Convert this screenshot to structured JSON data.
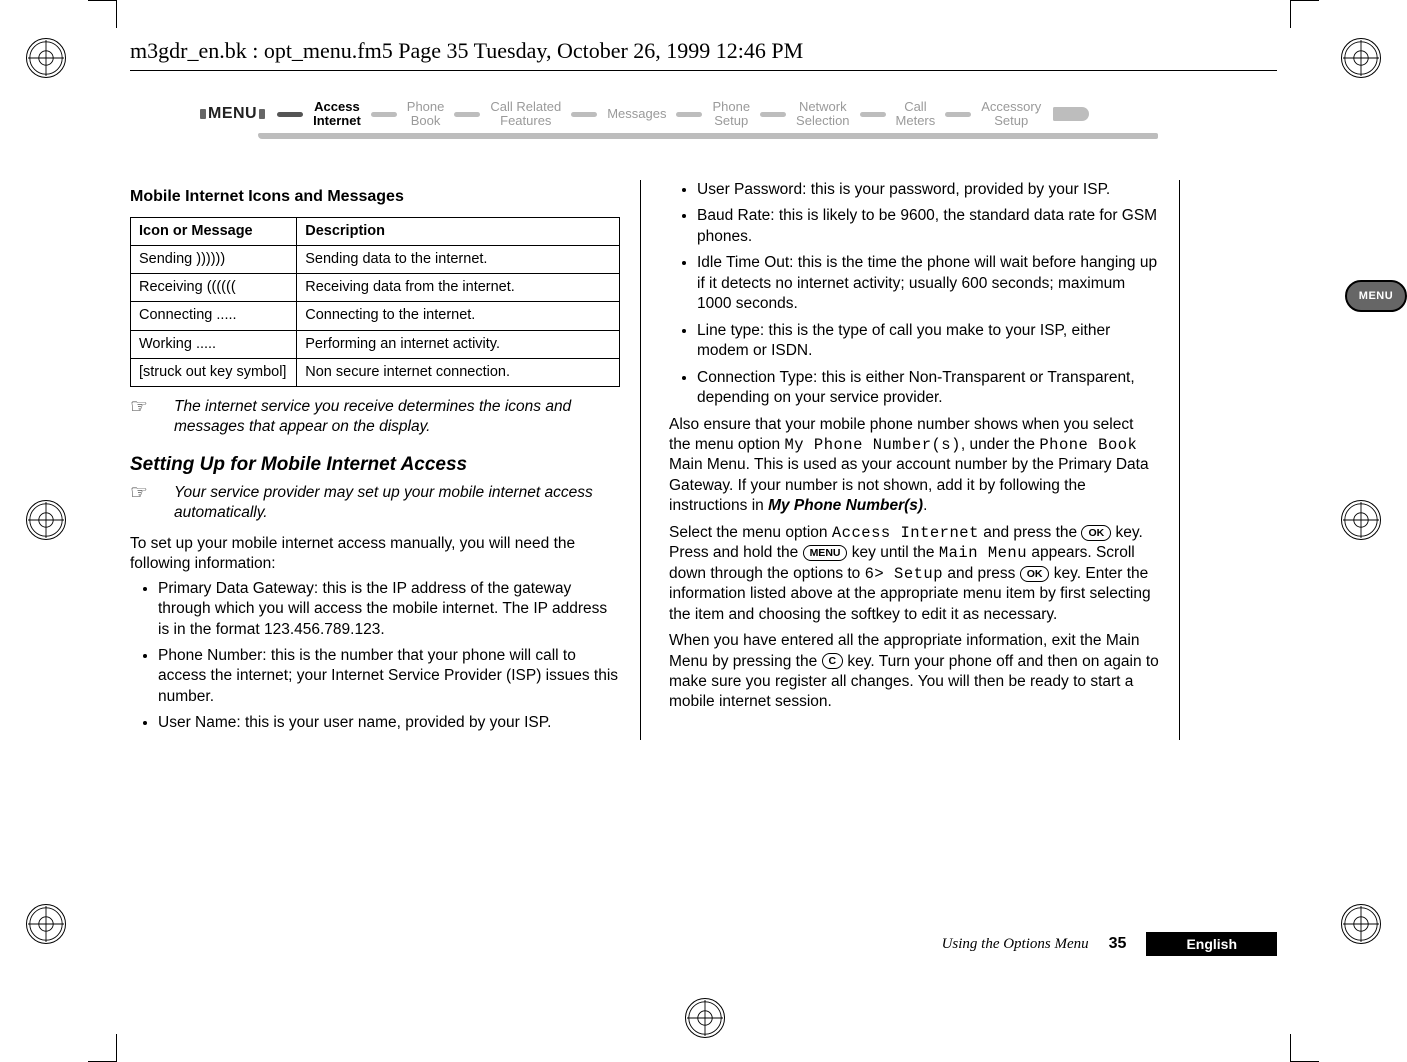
{
  "file_header": "m3gdr_en.bk : opt_menu.fm5  Page 35  Tuesday, October 26, 1999  12:46 PM",
  "menu": {
    "label": "MENU",
    "items": [
      {
        "top": "Access",
        "bottom": "Internet",
        "active": true
      },
      {
        "top": "Phone",
        "bottom": "Book",
        "active": false
      },
      {
        "top": "Call Related",
        "bottom": "Features",
        "active": false
      },
      {
        "top": "Messages",
        "bottom": "",
        "active": false
      },
      {
        "top": "Phone",
        "bottom": "Setup",
        "active": false
      },
      {
        "top": "Network",
        "bottom": "Selection",
        "active": false
      },
      {
        "top": "Call",
        "bottom": "Meters",
        "active": false
      },
      {
        "top": "Accessory",
        "bottom": "Setup",
        "active": false
      }
    ]
  },
  "left": {
    "section_title": "Mobile Internet Icons and Messages",
    "table_headers": {
      "col1": "Icon or Message",
      "col2": "Description"
    },
    "table_rows": [
      {
        "c1": "Sending ))))))",
        "c2": "Sending data to the internet."
      },
      {
        "c1": "Receiving ((((((",
        "c2": "Receiving data from the internet."
      },
      {
        "c1": "Connecting .....",
        "c2": "Connecting to the internet."
      },
      {
        "c1": "Working .....",
        "c2": "Performing an internet activity."
      },
      {
        "c1": "[struck out key symbol]",
        "c2": "Non secure internet connection."
      }
    ],
    "note1": "The internet service you receive determines the icons and messages that appear on the display.",
    "subheading": "Setting Up for Mobile Internet Access",
    "note2": "Your service provider may set up your mobile internet access automatically.",
    "para1": "To set up your mobile internet access manually, you will need the following information:",
    "bullets": [
      "Primary Data Gateway: this is the IP address of the gateway through which you will access the mobile internet. The IP address is in the format 123.456.789.123.",
      "Phone Number: this is the number that your phone will call to access the internet; your Internet Service Provider (ISP) issues this number.",
      "User Name: this is your user name, provided by your ISP."
    ]
  },
  "right": {
    "bullets": [
      "User Password: this is your password, provided by your ISP.",
      "Baud Rate: this is likely to be 9600, the standard data rate for GSM phones.",
      "Idle Time Out: this is the time the phone will wait before hanging up if it detects no internet activity; usually 600 seconds; maximum 1000 seconds.",
      "Line type: this is the type of call you make to your ISP, either modem or ISDN.",
      "Connection Type: this is either Non-Transparent or Transparent, depending on your service provider."
    ],
    "para1a": "Also ensure that your mobile phone number shows when you select the menu option ",
    "lcd1": "My Phone Number(s)",
    "para1b": ", under the ",
    "lcd2": "Phone Book",
    "para1c": " Main Menu. This is used as your account number by the Primary Data Gateway. If your number is not shown, add it by following the instructions in ",
    "bolditalic1": "My Phone Number(s)",
    "para1d": ".",
    "para2a": "Select the menu option ",
    "lcd3": "Access Internet",
    "para2b": " and press the ",
    "key_ok1": "OK",
    "para2c": " key. Press and hold the ",
    "key_menu": "MENU",
    "para2d": " key until the ",
    "lcd4": "Main Menu",
    "para2e": " appears. Scroll down through the options to ",
    "lcd5": "6> Setup",
    "para2f": " and press ",
    "key_ok2": "OK",
    "para2g": " key. Enter the information listed above at the appropriate menu item by first selecting the item and choosing the softkey to edit it as necessary.",
    "para3a": "When you have entered all the appropriate information, exit the Main Menu by pressing the ",
    "key_c": "C",
    "para3b": " key. Turn your phone off and then on again to make sure you register all changes. You will then be ready to start a mobile internet session.",
    "side_tab": "MENU"
  },
  "footer": {
    "section": "Using the Options Menu",
    "page": "35",
    "language": "English"
  },
  "note_icon_glyph": "☞"
}
